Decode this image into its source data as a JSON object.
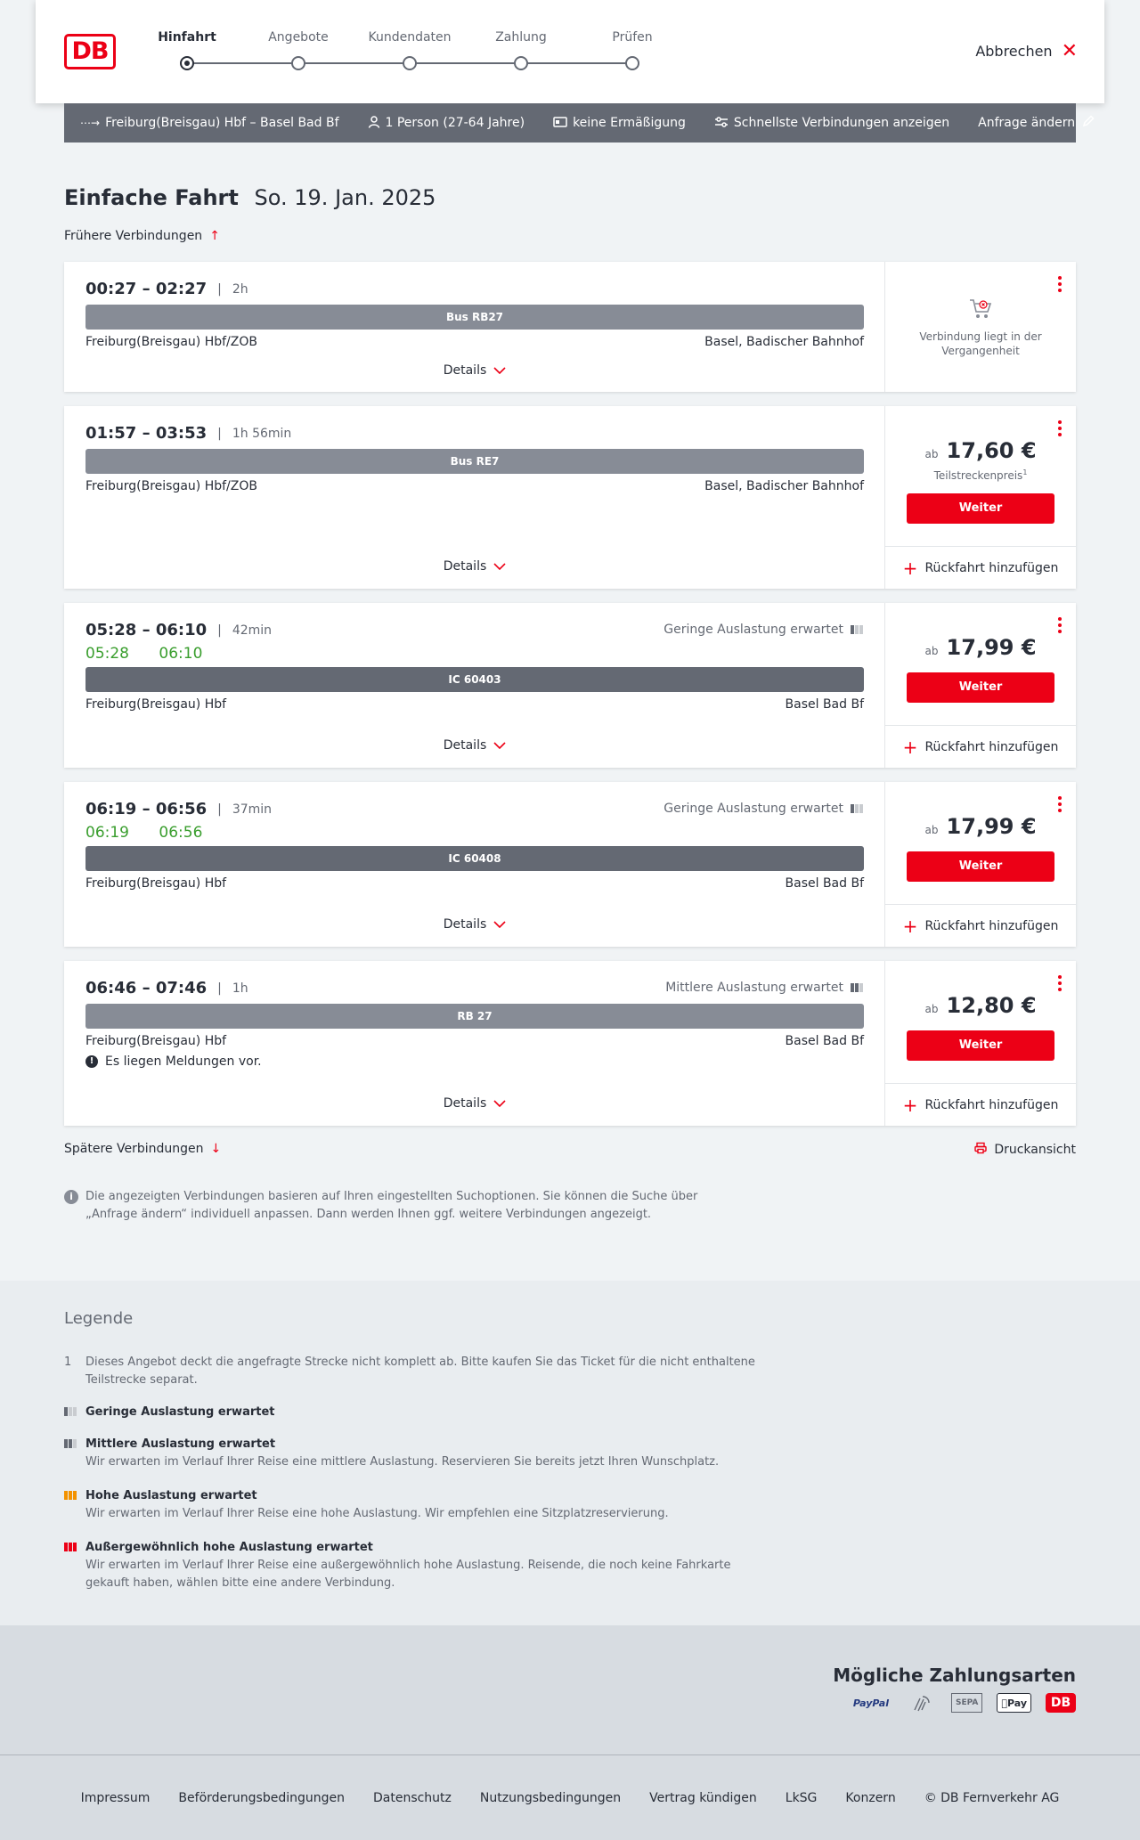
{
  "header": {
    "logo": "DB",
    "steps": [
      {
        "label": "Hinfahrt",
        "active": true
      },
      {
        "label": "Angebote",
        "active": false
      },
      {
        "label": "Kundendaten",
        "active": false
      },
      {
        "label": "Zahlung",
        "active": false
      },
      {
        "label": "Prüfen",
        "active": false
      }
    ],
    "cancel_label": "Abbrechen"
  },
  "query": {
    "route": "Freiburg(Breisgau) Hbf – Basel Bad Bf",
    "persons": "1 Person (27-64 Jahre)",
    "discount": "keine Ermäßigung",
    "fastest": "Schnellste Verbindungen anzeigen",
    "change_label": "Anfrage ändern"
  },
  "title": {
    "type": "Einfache Fahrt",
    "date": "So. 19. Jan. 2025"
  },
  "earlier_label": "Frühere Verbindungen",
  "later_label": "Spätere Verbindungen",
  "print_label": "Druckansicht",
  "connections": [
    {
      "times": "00:27 – 02:27",
      "duration": "2h",
      "train": "Bus RB27",
      "from": "Freiburg(Breisgau) Hbf/ZOB",
      "to": "Basel, Badischer Bahnhof",
      "details": "Details",
      "past_text": "Verbindung liegt in der Vergangenheit"
    },
    {
      "times": "01:57 – 03:53",
      "duration": "1h 56min",
      "train": "Bus RE7",
      "from": "Freiburg(Breisgau) Hbf/ZOB",
      "to": "Basel, Badischer Bahnhof",
      "details": "Details",
      "price_prefix": "ab",
      "price": "17,60 €",
      "price_note": "Teilstreckenpreis",
      "price_note_sup": "1",
      "button": "Weiter",
      "return": "Rückfahrt hinzufügen"
    },
    {
      "times": "05:28 – 06:10",
      "duration": "42min",
      "realtime_dep": "05:28",
      "realtime_arr": "06:10",
      "occupancy": "Geringe Auslastung erwartet",
      "train": "IC 60403",
      "from": "Freiburg(Breisgau) Hbf",
      "to": "Basel Bad Bf",
      "details": "Details",
      "price_prefix": "ab",
      "price": "17,99 €",
      "button": "Weiter",
      "return": "Rückfahrt hinzufügen"
    },
    {
      "times": "06:19 – 06:56",
      "duration": "37min",
      "realtime_dep": "06:19",
      "realtime_arr": "06:56",
      "occupancy": "Geringe Auslastung erwartet",
      "train": "IC 60408",
      "from": "Freiburg(Breisgau) Hbf",
      "to": "Basel Bad Bf",
      "details": "Details",
      "price_prefix": "ab",
      "price": "17,99 €",
      "button": "Weiter",
      "return": "Rückfahrt hinzufügen"
    },
    {
      "times": "06:46 – 07:46",
      "duration": "1h",
      "occupancy": "Mittlere Auslastung erwartet",
      "train": "RB 27",
      "from": "Freiburg(Breisgau) Hbf",
      "to": "Basel Bad Bf",
      "notice": "Es liegen Meldungen vor.",
      "details": "Details",
      "price_prefix": "ab",
      "price": "12,80 €",
      "button": "Weiter",
      "return": "Rückfahrt hinzufügen"
    }
  ],
  "info_text": "Die angezeigten Verbindungen basieren auf Ihren eingestellten Suchoptionen. Sie können die Suche über „Anfrage ändern“ individuell anpassen. Dann werden Ihnen ggf. weitere Verbindungen angezeigt.",
  "legend": {
    "title": "Legende",
    "note_number": "1",
    "note_text": "Dieses Angebot deckt die angefragte Strecke nicht komplett ab. Bitte kaufen Sie das Ticket für die nicht enthaltene Teilstrecke separat.",
    "items": [
      {
        "title": "Geringe Auslastung erwartet",
        "text": ""
      },
      {
        "title": "Mittlere Auslastung erwartet",
        "text": "Wir erwarten im Verlauf Ihrer Reise eine mittlere Auslastung. Reservieren Sie bereits jetzt Ihren Wunschplatz."
      },
      {
        "title": "Hohe Auslastung erwartet",
        "text": "Wir erwarten im Verlauf Ihrer Reise eine hohe Auslastung. Wir empfehlen eine Sitzplatzreservierung."
      },
      {
        "title": "Außergewöhnlich hohe Auslastung erwartet",
        "text": "Wir erwarten im Verlauf Ihrer Reise eine außergewöhnlich hohe Auslastung. Reisende, die noch keine Fahrkarte gekauft haben, wählen bitte eine andere Verbindung."
      }
    ]
  },
  "payment": {
    "title": "Mögliche Zahlungsarten",
    "methods": [
      "PayPal",
      "Kreditkarte",
      "SEPA",
      "Pay",
      "DB"
    ]
  },
  "footer": {
    "links": [
      "Impressum",
      "Beförderungsbedingungen",
      "Datenschutz",
      "Nutzungsbedingungen",
      "Vertrag kündigen",
      "LkSG",
      "Konzern",
      "© DB Fernverkehr AG"
    ]
  },
  "colors": {
    "brand_red": "#ec0016",
    "realtime_green": "#3a9e2e",
    "bar_grey": "#646973"
  }
}
